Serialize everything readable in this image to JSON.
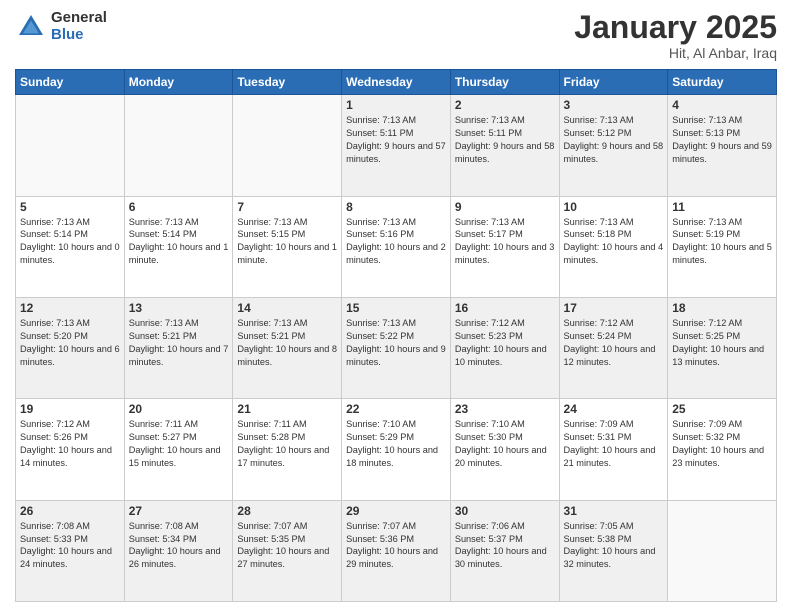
{
  "logo": {
    "general": "General",
    "blue": "Blue"
  },
  "header": {
    "title": "January 2025",
    "location": "Hit, Al Anbar, Iraq"
  },
  "days_of_week": [
    "Sunday",
    "Monday",
    "Tuesday",
    "Wednesday",
    "Thursday",
    "Friday",
    "Saturday"
  ],
  "weeks": [
    [
      {
        "day": "",
        "text": "",
        "empty": true
      },
      {
        "day": "",
        "text": "",
        "empty": true
      },
      {
        "day": "",
        "text": "",
        "empty": true
      },
      {
        "day": "1",
        "sunrise": "7:13 AM",
        "sunset": "5:11 PM",
        "daylight": "9 hours and 57 minutes."
      },
      {
        "day": "2",
        "sunrise": "7:13 AM",
        "sunset": "5:11 PM",
        "daylight": "9 hours and 58 minutes."
      },
      {
        "day": "3",
        "sunrise": "7:13 AM",
        "sunset": "5:12 PM",
        "daylight": "9 hours and 58 minutes."
      },
      {
        "day": "4",
        "sunrise": "7:13 AM",
        "sunset": "5:13 PM",
        "daylight": "9 hours and 59 minutes."
      }
    ],
    [
      {
        "day": "5",
        "sunrise": "7:13 AM",
        "sunset": "5:14 PM",
        "daylight": "10 hours and 0 minutes."
      },
      {
        "day": "6",
        "sunrise": "7:13 AM",
        "sunset": "5:14 PM",
        "daylight": "10 hours and 1 minute."
      },
      {
        "day": "7",
        "sunrise": "7:13 AM",
        "sunset": "5:15 PM",
        "daylight": "10 hours and 1 minute."
      },
      {
        "day": "8",
        "sunrise": "7:13 AM",
        "sunset": "5:16 PM",
        "daylight": "10 hours and 2 minutes."
      },
      {
        "day": "9",
        "sunrise": "7:13 AM",
        "sunset": "5:17 PM",
        "daylight": "10 hours and 3 minutes."
      },
      {
        "day": "10",
        "sunrise": "7:13 AM",
        "sunset": "5:18 PM",
        "daylight": "10 hours and 4 minutes."
      },
      {
        "day": "11",
        "sunrise": "7:13 AM",
        "sunset": "5:19 PM",
        "daylight": "10 hours and 5 minutes."
      }
    ],
    [
      {
        "day": "12",
        "sunrise": "7:13 AM",
        "sunset": "5:20 PM",
        "daylight": "10 hours and 6 minutes."
      },
      {
        "day": "13",
        "sunrise": "7:13 AM",
        "sunset": "5:21 PM",
        "daylight": "10 hours and 7 minutes."
      },
      {
        "day": "14",
        "sunrise": "7:13 AM",
        "sunset": "5:21 PM",
        "daylight": "10 hours and 8 minutes."
      },
      {
        "day": "15",
        "sunrise": "7:13 AM",
        "sunset": "5:22 PM",
        "daylight": "10 hours and 9 minutes."
      },
      {
        "day": "16",
        "sunrise": "7:12 AM",
        "sunset": "5:23 PM",
        "daylight": "10 hours and 10 minutes."
      },
      {
        "day": "17",
        "sunrise": "7:12 AM",
        "sunset": "5:24 PM",
        "daylight": "10 hours and 12 minutes."
      },
      {
        "day": "18",
        "sunrise": "7:12 AM",
        "sunset": "5:25 PM",
        "daylight": "10 hours and 13 minutes."
      }
    ],
    [
      {
        "day": "19",
        "sunrise": "7:12 AM",
        "sunset": "5:26 PM",
        "daylight": "10 hours and 14 minutes."
      },
      {
        "day": "20",
        "sunrise": "7:11 AM",
        "sunset": "5:27 PM",
        "daylight": "10 hours and 15 minutes."
      },
      {
        "day": "21",
        "sunrise": "7:11 AM",
        "sunset": "5:28 PM",
        "daylight": "10 hours and 17 minutes."
      },
      {
        "day": "22",
        "sunrise": "7:10 AM",
        "sunset": "5:29 PM",
        "daylight": "10 hours and 18 minutes."
      },
      {
        "day": "23",
        "sunrise": "7:10 AM",
        "sunset": "5:30 PM",
        "daylight": "10 hours and 20 minutes."
      },
      {
        "day": "24",
        "sunrise": "7:09 AM",
        "sunset": "5:31 PM",
        "daylight": "10 hours and 21 minutes."
      },
      {
        "day": "25",
        "sunrise": "7:09 AM",
        "sunset": "5:32 PM",
        "daylight": "10 hours and 23 minutes."
      }
    ],
    [
      {
        "day": "26",
        "sunrise": "7:08 AM",
        "sunset": "5:33 PM",
        "daylight": "10 hours and 24 minutes."
      },
      {
        "day": "27",
        "sunrise": "7:08 AM",
        "sunset": "5:34 PM",
        "daylight": "10 hours and 26 minutes."
      },
      {
        "day": "28",
        "sunrise": "7:07 AM",
        "sunset": "5:35 PM",
        "daylight": "10 hours and 27 minutes."
      },
      {
        "day": "29",
        "sunrise": "7:07 AM",
        "sunset": "5:36 PM",
        "daylight": "10 hours and 29 minutes."
      },
      {
        "day": "30",
        "sunrise": "7:06 AM",
        "sunset": "5:37 PM",
        "daylight": "10 hours and 30 minutes."
      },
      {
        "day": "31",
        "sunrise": "7:05 AM",
        "sunset": "5:38 PM",
        "daylight": "10 hours and 32 minutes."
      },
      {
        "day": "",
        "text": "",
        "empty": true
      }
    ]
  ]
}
